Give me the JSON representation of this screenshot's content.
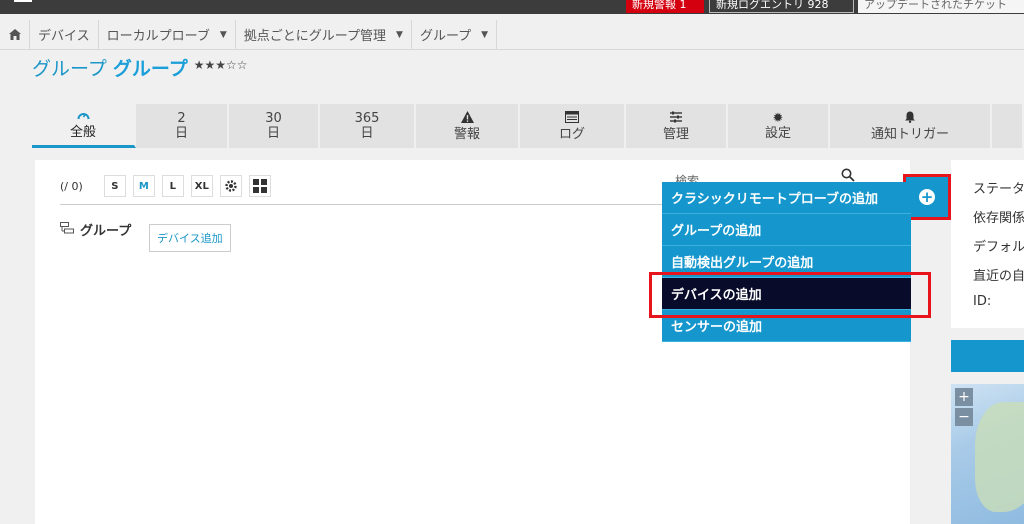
{
  "topbar": {
    "new_alarms": "新規警報 1",
    "new_log": "新規ログエントリ 928",
    "updated": "アップデートされたチケット"
  },
  "breadcrumb": [
    "デバイス",
    "ローカルプローブ",
    "拠点ごとにグループ管理",
    "グループ"
  ],
  "page": {
    "title_prefix": "グループ",
    "title_bold": "グループ",
    "stars": "★★★☆☆"
  },
  "tabs": [
    {
      "line1": "",
      "line2": "全般",
      "icon": "gauge-icon"
    },
    {
      "line1": "2",
      "line2": "日"
    },
    {
      "line1": "30",
      "line2": "日"
    },
    {
      "line1": "365",
      "line2": "日"
    },
    {
      "line1": "",
      "line2": "警報",
      "icon": "warning-icon"
    },
    {
      "line1": "",
      "line2": "ログ",
      "icon": "log-icon"
    },
    {
      "line1": "",
      "line2": "管理",
      "icon": "sliders-icon"
    },
    {
      "line1": "",
      "line2": "設定",
      "icon": "gear-icon"
    },
    {
      "line1": "",
      "line2": "通知トリガー",
      "icon": "bell-icon"
    }
  ],
  "toolbar": {
    "count": "(/ 0)",
    "sizes": [
      "S",
      "M",
      "L",
      "XL"
    ],
    "search_placeholder": "検索"
  },
  "tree": {
    "group_label": "グループ",
    "add_device": "デバイス追加"
  },
  "menu": {
    "items": [
      "クラシックリモートプローブの追加",
      "グループの追加",
      "自動検出グループの追加",
      "デバイスの追加",
      "センサーの追加"
    ],
    "selected_index": 3
  },
  "info": {
    "rows": [
      "ステータス",
      "依存関係",
      "デフォルト",
      "直近の自動",
      "ID:"
    ]
  },
  "colors": {
    "accent": "#1596cc",
    "selected": "#080c2a",
    "highlight": "#e8141b",
    "alarm": "#d4000f"
  }
}
